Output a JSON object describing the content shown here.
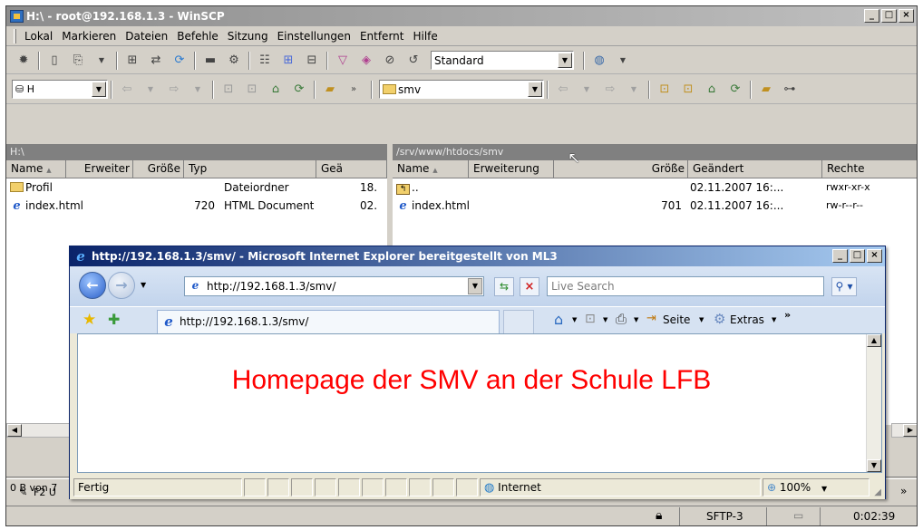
{
  "winscp": {
    "title": "H:\\ - root@192.168.1.3 - WinSCP",
    "menu": [
      "Lokal",
      "Markieren",
      "Dateien",
      "Befehle",
      "Sitzung",
      "Einstellungen",
      "Entfernt",
      "Hilfe"
    ],
    "transfer_preset": "Standard",
    "local": {
      "path": "H:\\",
      "columns": [
        "Name",
        "Erweiter",
        "Größe",
        "Typ",
        "Geä"
      ],
      "files": [
        {
          "name": "Profil",
          "ext": "",
          "size": "",
          "type": "Dateiordner",
          "changed": "18."
        },
        {
          "name": "index.html",
          "ext": "",
          "size": "720",
          "type": "HTML Document",
          "changed": "02."
        }
      ]
    },
    "remote": {
      "path": "/srv/www/htdocs/smv",
      "folder_select": "smv",
      "columns": [
        "Name",
        "Erweiterung",
        "Größe",
        "Geändert",
        "Rechte"
      ],
      "files": [
        {
          "name": "..",
          "ext": "",
          "size": "",
          "changed": "02.11.2007 16:...",
          "rights": "rwxr-xr-x"
        },
        {
          "name": "index.html",
          "ext": "",
          "size": "701",
          "changed": "02.11.2007 16:...",
          "rights": "rw-r--r--"
        }
      ]
    },
    "status_left": "0 B von 7",
    "f2_label": "F2 U",
    "protocol": "SFTP-3",
    "time": "0:02:39",
    "colors": {
      "inactive_title": "#8d8d8d",
      "path_bar": "#808080"
    }
  },
  "ie": {
    "title": "http://192.168.1.3/smv/ - Microsoft Internet Explorer bereitgestellt von ML3",
    "address": "http://192.168.1.3/smv/",
    "search_placeholder": "Live Search",
    "tab_title": "http://192.168.1.3/smv/",
    "cmd_page": "Seite",
    "cmd_extras": "Extras",
    "page_heading": "Homepage der SMV an der Schule LFB",
    "status_text": "Fertig",
    "zone": "Internet",
    "zoom": "100%",
    "colors": {
      "active_title": "#0a246a",
      "heading": "#ff0000"
    }
  }
}
